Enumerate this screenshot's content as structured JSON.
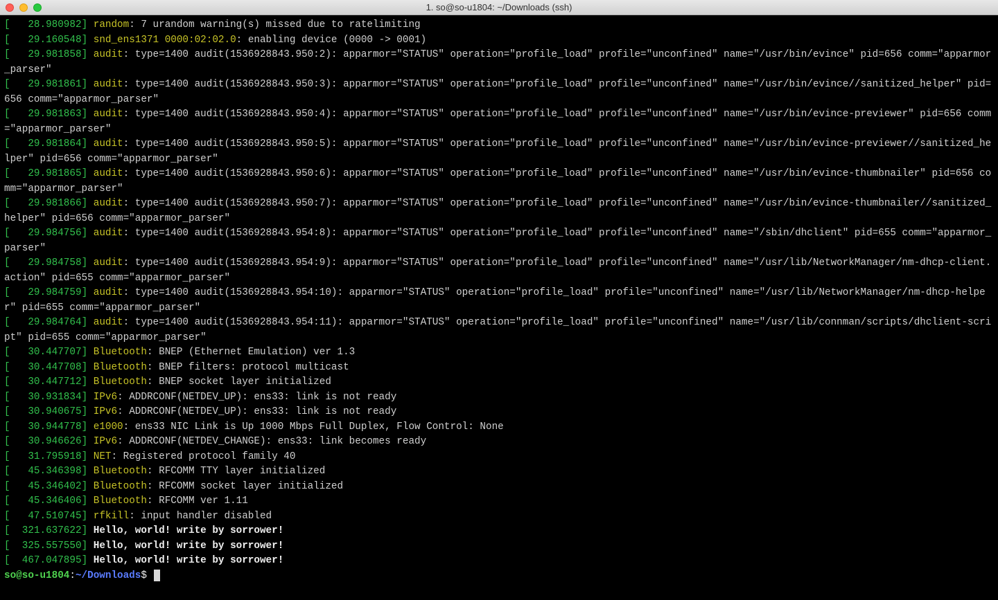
{
  "window": {
    "title": "1. so@so-u1804: ~/Downloads (ssh)"
  },
  "prompt": {
    "user_host": "so@so-u1804",
    "colon": ":",
    "path": "~/Downloads",
    "suffix": "$ "
  },
  "colors": {
    "bracket": "#32c24d",
    "timestamp": "#32c24d",
    "subsystem": "#c7c327",
    "boldwhite": "#eee",
    "blue": "#3465ff"
  },
  "lines": [
    {
      "ts": "28.980982",
      "sub": "random",
      "msg": ": 7 urandom warning(s) missed due to ratelimiting"
    },
    {
      "ts": "29.160548",
      "sub": "snd_ens1371 0000:02:02.0",
      "msg": ": enabling device (0000 -> 0001)"
    },
    {
      "ts": "29.981858",
      "sub": "audit",
      "msg": ": type=1400 audit(1536928843.950:2): apparmor=\"STATUS\" operation=\"profile_load\" profile=\"unconfined\" name=\"/usr/bin/evince\" pid=656 comm=\"apparmor_parser\""
    },
    {
      "ts": "29.981861",
      "sub": "audit",
      "msg": ": type=1400 audit(1536928843.950:3): apparmor=\"STATUS\" operation=\"profile_load\" profile=\"unconfined\" name=\"/usr/bin/evince//sanitized_helper\" pid=656 comm=\"apparmor_parser\""
    },
    {
      "ts": "29.981863",
      "sub": "audit",
      "msg": ": type=1400 audit(1536928843.950:4): apparmor=\"STATUS\" operation=\"profile_load\" profile=\"unconfined\" name=\"/usr/bin/evince-previewer\" pid=656 comm=\"apparmor_parser\""
    },
    {
      "ts": "29.981864",
      "sub": "audit",
      "msg": ": type=1400 audit(1536928843.950:5): apparmor=\"STATUS\" operation=\"profile_load\" profile=\"unconfined\" name=\"/usr/bin/evince-previewer//sanitized_helper\" pid=656 comm=\"apparmor_parser\""
    },
    {
      "ts": "29.981865",
      "sub": "audit",
      "msg": ": type=1400 audit(1536928843.950:6): apparmor=\"STATUS\" operation=\"profile_load\" profile=\"unconfined\" name=\"/usr/bin/evince-thumbnailer\" pid=656 comm=\"apparmor_parser\""
    },
    {
      "ts": "29.981866",
      "sub": "audit",
      "msg": ": type=1400 audit(1536928843.950:7): apparmor=\"STATUS\" operation=\"profile_load\" profile=\"unconfined\" name=\"/usr/bin/evince-thumbnailer//sanitized_helper\" pid=656 comm=\"apparmor_parser\""
    },
    {
      "ts": "29.984756",
      "sub": "audit",
      "msg": ": type=1400 audit(1536928843.954:8): apparmor=\"STATUS\" operation=\"profile_load\" profile=\"unconfined\" name=\"/sbin/dhclient\" pid=655 comm=\"apparmor_parser\""
    },
    {
      "ts": "29.984758",
      "sub": "audit",
      "msg": ": type=1400 audit(1536928843.954:9): apparmor=\"STATUS\" operation=\"profile_load\" profile=\"unconfined\" name=\"/usr/lib/NetworkManager/nm-dhcp-client.action\" pid=655 comm=\"apparmor_parser\""
    },
    {
      "ts": "29.984759",
      "sub": "audit",
      "msg": ": type=1400 audit(1536928843.954:10): apparmor=\"STATUS\" operation=\"profile_load\" profile=\"unconfined\" name=\"/usr/lib/NetworkManager/nm-dhcp-helper\" pid=655 comm=\"apparmor_parser\""
    },
    {
      "ts": "29.984764",
      "sub": "audit",
      "msg": ": type=1400 audit(1536928843.954:11): apparmor=\"STATUS\" operation=\"profile_load\" profile=\"unconfined\" name=\"/usr/lib/connman/scripts/dhclient-script\" pid=655 comm=\"apparmor_parser\""
    },
    {
      "ts": "30.447707",
      "sub": "Bluetooth",
      "msg": ": BNEP (Ethernet Emulation) ver 1.3"
    },
    {
      "ts": "30.447708",
      "sub": "Bluetooth",
      "msg": ": BNEP filters: protocol multicast"
    },
    {
      "ts": "30.447712",
      "sub": "Bluetooth",
      "msg": ": BNEP socket layer initialized"
    },
    {
      "ts": "30.931834",
      "sub": "IPv6",
      "msg": ": ADDRCONF(NETDEV_UP): ens33: link is not ready"
    },
    {
      "ts": "30.940675",
      "sub": "IPv6",
      "msg": ": ADDRCONF(NETDEV_UP): ens33: link is not ready"
    },
    {
      "ts": "30.944778",
      "sub": "e1000",
      "msg": ": ens33 NIC Link is Up 1000 Mbps Full Duplex, Flow Control: None"
    },
    {
      "ts": "30.946626",
      "sub": "IPv6",
      "msg": ": ADDRCONF(NETDEV_CHANGE): ens33: link becomes ready"
    },
    {
      "ts": "31.795918",
      "sub": "NET",
      "msg": ": Registered protocol family 40"
    },
    {
      "ts": "45.346398",
      "sub": "Bluetooth",
      "msg": ": RFCOMM TTY layer initialized"
    },
    {
      "ts": "45.346402",
      "sub": "Bluetooth",
      "msg": ": RFCOMM socket layer initialized"
    },
    {
      "ts": "45.346406",
      "sub": "Bluetooth",
      "msg": ": RFCOMM ver 1.11"
    },
    {
      "ts": "47.510745",
      "sub": "rfkill",
      "msg": ": input handler disabled"
    },
    {
      "ts": "321.637622",
      "bold": true,
      "msg": "Hello, world! write by sorrower!"
    },
    {
      "ts": "325.557550",
      "bold": true,
      "msg": "Hello, world! write by sorrower!"
    },
    {
      "ts": "467.047895",
      "bold": true,
      "msg": "Hello, world! write by sorrower!"
    }
  ]
}
